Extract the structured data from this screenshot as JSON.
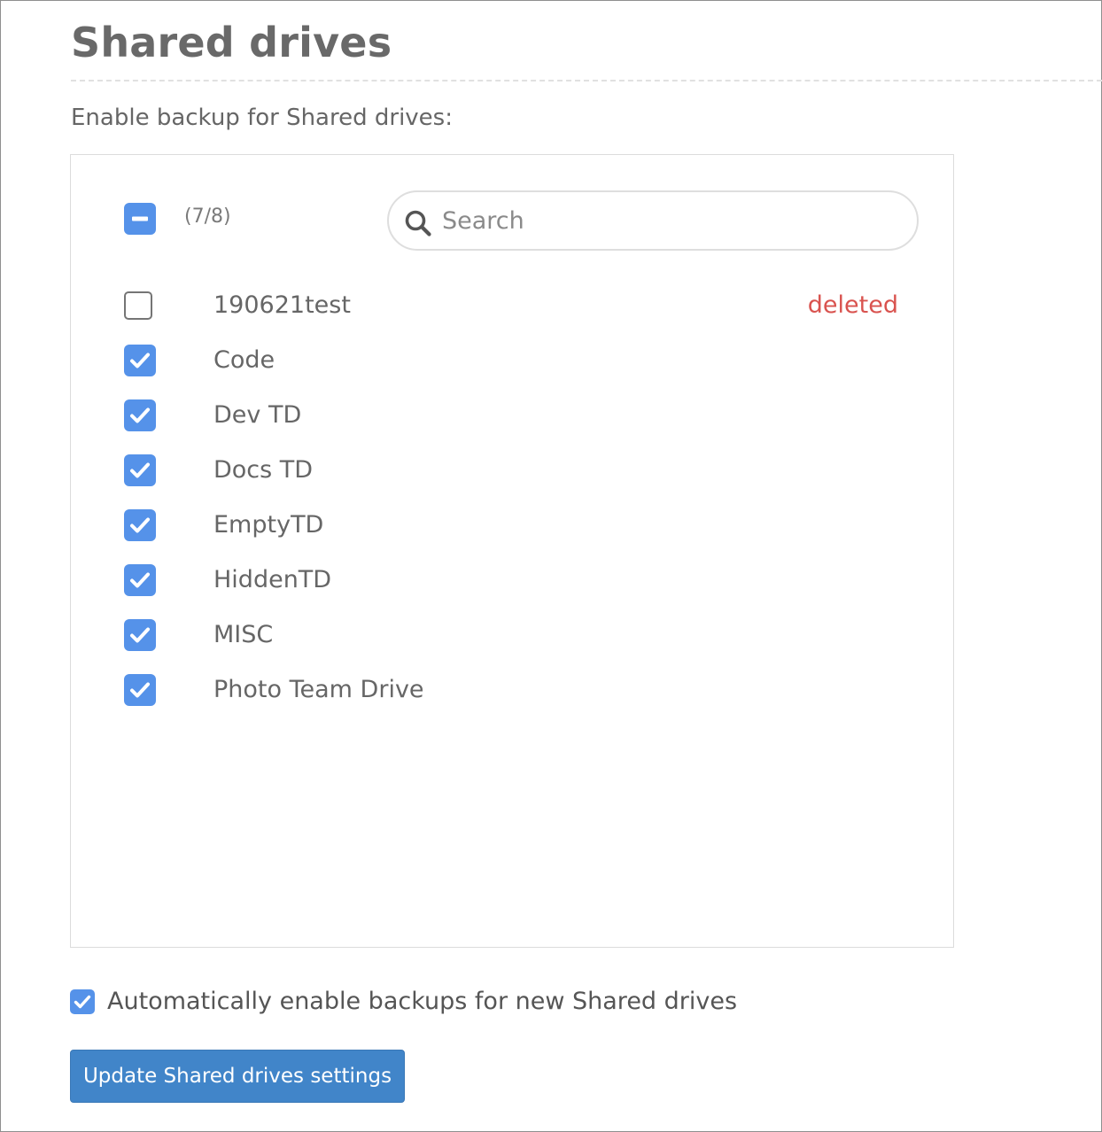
{
  "page": {
    "title": "Shared drives",
    "subtitle": "Enable backup for Shared drives:"
  },
  "drive_list": {
    "select_all_state": "indeterminate",
    "selection_count": "(7/8)",
    "search": {
      "placeholder": "Search",
      "value": ""
    },
    "items": [
      {
        "label": "190621test",
        "checked": false,
        "status": "deleted"
      },
      {
        "label": "Code",
        "checked": true,
        "status": ""
      },
      {
        "label": "Dev TD",
        "checked": true,
        "status": ""
      },
      {
        "label": "Docs TD",
        "checked": true,
        "status": ""
      },
      {
        "label": "EmptyTD",
        "checked": true,
        "status": ""
      },
      {
        "label": "HiddenTD",
        "checked": true,
        "status": ""
      },
      {
        "label": "MISC",
        "checked": true,
        "status": ""
      },
      {
        "label": "Photo Team Drive",
        "checked": true,
        "status": ""
      }
    ]
  },
  "auto_enable": {
    "label": "Automatically enable backups for new Shared drives",
    "checked": true
  },
  "update_button": {
    "label": "Update Shared drives settings"
  },
  "colors": {
    "accent": "#5592e9",
    "button": "#4185c9",
    "deleted": "#d9534f"
  },
  "icons": {
    "select_all": "minus-icon",
    "search": "search-icon",
    "checked": "check-icon"
  }
}
